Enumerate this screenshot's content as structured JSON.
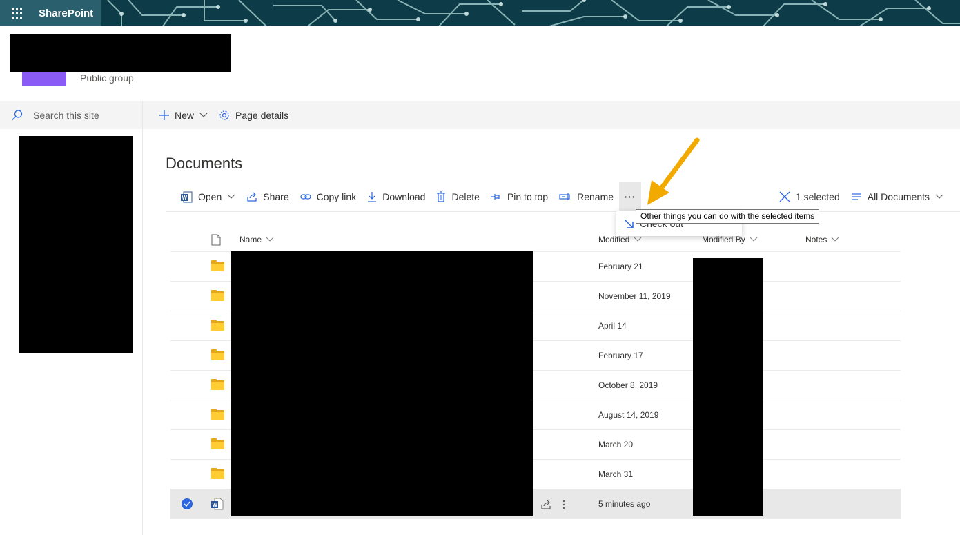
{
  "suite_bar": {
    "app_name": "SharePoint"
  },
  "site": {
    "privacy_label": "Public group"
  },
  "left_nav": {
    "search_placeholder": "Search this site"
  },
  "top_commands": {
    "new_label": "New",
    "page_details_label": "Page details"
  },
  "page_title": "Documents",
  "commands": {
    "open": "Open",
    "share": "Share",
    "copy_link": "Copy link",
    "download": "Download",
    "delete": "Delete",
    "pin_to_top": "Pin to top",
    "rename": "Rename",
    "more": "···",
    "selected_count": "1 selected",
    "view": "All Documents"
  },
  "tooltip": "Other things you can do with the selected items",
  "overflow_menu": {
    "check_out": "Check out"
  },
  "columns": {
    "name": "Name",
    "modified": "Modified",
    "modified_by": "Modified By",
    "notes": "Notes"
  },
  "rows": [
    {
      "type": "folder",
      "modified": "February 21"
    },
    {
      "type": "folder",
      "modified": "November 11, 2019"
    },
    {
      "type": "folder",
      "modified": "April 14"
    },
    {
      "type": "folder",
      "modified": "February 17"
    },
    {
      "type": "folder",
      "modified": "October 8, 2019"
    },
    {
      "type": "folder",
      "modified": "August 14, 2019"
    },
    {
      "type": "folder",
      "modified": "March 20"
    },
    {
      "type": "folder",
      "modified": "March 31"
    },
    {
      "type": "word-document",
      "modified": "5 minutes ago",
      "selected": true
    }
  ],
  "colors": {
    "accent": "#2b66e0",
    "suite_bar": "#0c3b47",
    "annotation_arrow": "#f2a900",
    "site_logo": "#8a5cf5",
    "folder": "#ffcc33"
  }
}
